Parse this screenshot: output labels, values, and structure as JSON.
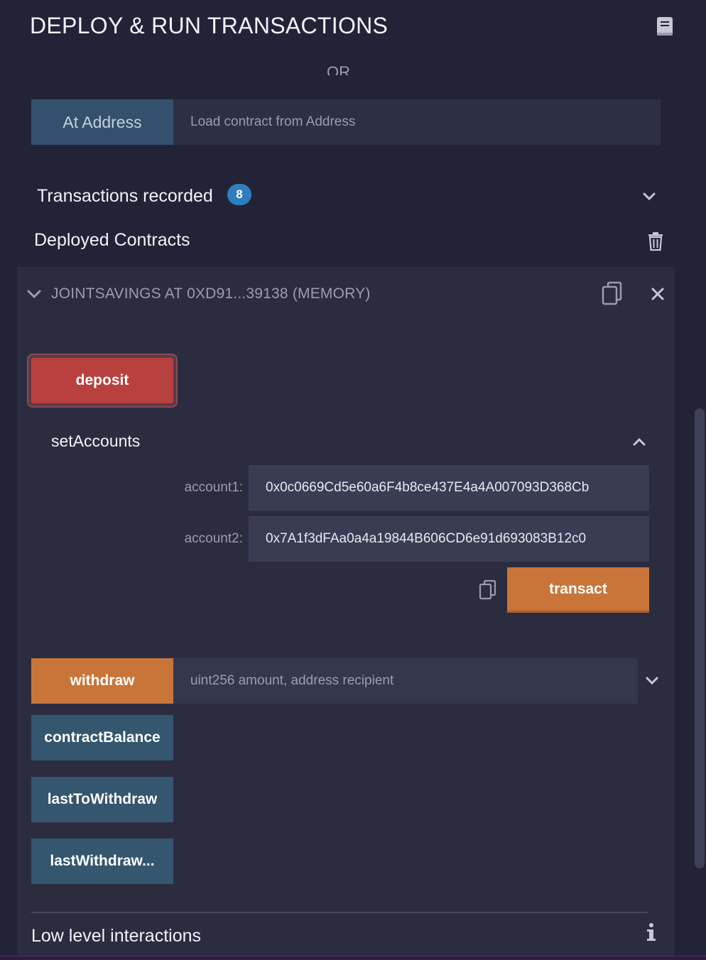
{
  "header": {
    "title": "DEPLOY & RUN TRANSACTIONS",
    "doc_icon": "book-icon"
  },
  "at_address": {
    "or_text": "OR",
    "button_label": "At Address",
    "input_placeholder": "Load contract from Address"
  },
  "transactions": {
    "label": "Transactions recorded",
    "count": "8"
  },
  "deployed": {
    "label": "Deployed Contracts"
  },
  "contract": {
    "title": "JOINTSAVINGS AT 0XD91...39138 (MEMORY)",
    "deposit_label": "deposit",
    "set_accounts": {
      "label": "setAccounts",
      "params": [
        {
          "name": "account1:",
          "value": "0x0c0669Cd5e60a6F4b8ce437E4a4A007093D368Cb"
        },
        {
          "name": "account2:",
          "value": "0x7A1f3dFAa0a4a19844B606CD6e91d693083B12c0"
        }
      ],
      "transact_label": "transact"
    },
    "withdraw": {
      "label": "withdraw",
      "placeholder": "uint256 amount, address recipient"
    },
    "calls": [
      "contractBalance",
      "lastToWithdraw",
      "lastWithdraw..."
    ],
    "low_level_label": "Low level interactions"
  },
  "colors": {
    "background": "#222336",
    "deposit": "#b8413f",
    "transact": "#c97539",
    "call": "#34566f",
    "badge": "#2f7fbf"
  }
}
